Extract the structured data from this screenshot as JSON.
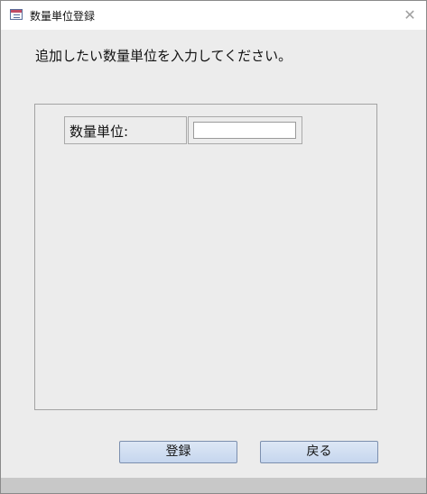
{
  "window": {
    "title": "数量単位登録",
    "close_glyph": "✕"
  },
  "instruction": "追加したい数量単位を入力してください。",
  "form": {
    "unit_label": "数量単位:",
    "unit_value": "",
    "unit_placeholder": ""
  },
  "buttons": {
    "register_label": "登録",
    "back_label": "戻る"
  },
  "colors": {
    "window_bg": "#ececec",
    "button_face": "#c6d6ee",
    "button_border": "#7c8fae"
  }
}
